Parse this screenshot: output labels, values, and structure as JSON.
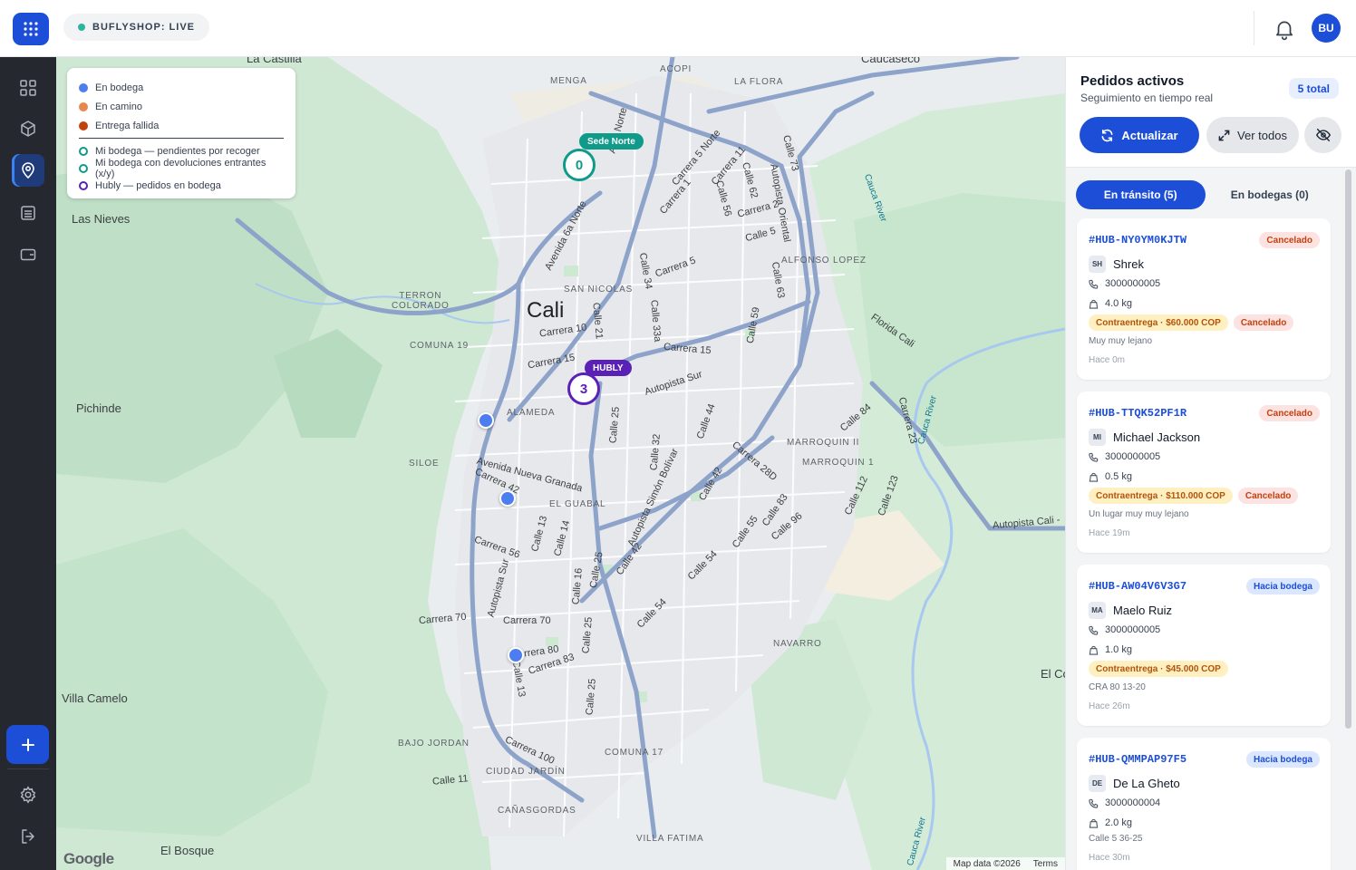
{
  "topbar": {
    "status_label": "BUFLYSHOP: LIVE",
    "avatar_initials": "BU",
    "colors": {
      "accent": "#1d4ed8",
      "status_dot": "#2bb5a0",
      "sidebar": "#25292f"
    }
  },
  "sidebar": {
    "items": [
      {
        "icon": "grid-icon",
        "active": false
      },
      {
        "icon": "package-icon",
        "active": false
      },
      {
        "icon": "map-pin-icon",
        "active": true
      },
      {
        "icon": "list-icon",
        "active": false
      },
      {
        "icon": "wallet-icon",
        "active": false
      }
    ],
    "bottom": [
      "plus-icon",
      "settings-icon",
      "logout-icon"
    ]
  },
  "map": {
    "legend": {
      "items": [
        {
          "label": "En bodega",
          "kind": "dot",
          "color": "#4d7ef0"
        },
        {
          "label": "En camino",
          "kind": "dot",
          "color": "#e8864d"
        },
        {
          "label": "Entrega fallida",
          "kind": "dot",
          "color": "#c2410c"
        },
        {
          "label": "Mi bodega — pendientes por recoger",
          "kind": "ring",
          "color": "#0f9a8a"
        },
        {
          "label": "Mi bodega con devoluciones entrantes (x/y)",
          "kind": "ring",
          "color": "#0f9a8a"
        },
        {
          "label": "Hubly — pedidos en bodega",
          "kind": "ring",
          "color": "#5b21b6"
        }
      ]
    },
    "clusters": {
      "sede_norte": {
        "tag": "Sede Norte",
        "count": "0",
        "color": "#0f9a8a"
      },
      "hubly": {
        "tag": "HUBLY",
        "count": "3",
        "color": "#5b21b6"
      }
    },
    "labels": {
      "la_castilla": "La Castilla",
      "cauca_seco": "Caucaseco",
      "acopi": "ACOPI",
      "menga": "MENGA",
      "la_flora": "LA FLORA",
      "las_nieves": "Las Nieves",
      "terron": "TERRON\nCOLORADO",
      "cali": "Cali",
      "san_nicolas": "SAN NICOLAS",
      "comuna19": "COMUNA 19",
      "pichinde": "Pichinde",
      "alameda": "ALAMEDA",
      "siloe": "SILOE",
      "el_guabal": "EL GUABAL",
      "alfonso_lopez": "ALFONSO LOPEZ",
      "marroquin2": "MARROQUIN II",
      "marroquin1": "MARROQUIN 1",
      "navarro": "NAVARRO",
      "villa_camelo": "Villa Camelo",
      "bajo_jordan": "BAJO JORDAN",
      "comuna17": "COMUNA 17",
      "ciudad_jardin": "CIUDAD JARDÍN",
      "canasgordas": "CAÑASGORDAS",
      "el_bosque": "El Bosque",
      "villa_fatima": "VILLA FATIMA",
      "el_co": "El Co",
      "av_6a": "Avenida 6a Norte",
      "av_4n": "Av 4 Norte",
      "carrera10": "Carrera 10",
      "carrera15a": "Carrera 15",
      "carrera15b": "Carrera 15",
      "carrera5": "Carrera 5",
      "carrera70": "Carrera 70",
      "carrera70b": "Carrera 70",
      "carrera80": "rrera 80",
      "carrera83": "Carrera 83",
      "autopista_sur": "Autopista Sur",
      "calle5": "Calle 5",
      "autopista_sur2": "Autopista Sur",
      "av_nueva_granada": "Avenida Nueva Granada",
      "carrera42": "Carrera 42",
      "carrera56": "Carrera 56",
      "calle25": "Calle 25",
      "calle44": "Calle 44",
      "calle100": "Carrera 100",
      "calle11": "Calle 11",
      "autopista_cali": "Autopista Cali -",
      "florida_cali": "Florida Cali",
      "cauca_river": "Cauca River",
      "cauca_river2": "Cauca River",
      "cauca_river3": "Cauca River",
      "calle73": "Calle 73",
      "calle62": "Calle 62",
      "calle56": "Calle 56",
      "calle34": "Calle 34",
      "calle33a": "Calle 33a",
      "calle21": "Calle 21",
      "calle59": "Calle 59",
      "calle63": "Calle 63",
      "calle84": "Calle 84",
      "calle112": "Calle 112",
      "calle123": "Calle 123",
      "calle13": "Calle 13",
      "calle14": "Calle 14",
      "calle16": "Calle 16",
      "carrera1": "Carrera 1",
      "carrera2": "Carrera 2",
      "carrera5n": "Carrera 5 Norte",
      "carrera11": "Carrera 11",
      "carrera23": "Carrera 23",
      "carrera28d": "Carrera 28D",
      "autopista_oriental": "Autopista Oriental",
      "autopista_simon": "Autopista Simón Bolívar",
      "calle42": "Calle 42",
      "calle54": "Calle 54",
      "calle32": "Calle 32",
      "calle55": "Calle 55",
      "calle83": "Calle 83",
      "calle96": "Calle 96",
      "calle13b": "Calle 13",
      "calle25b": "Calle 25",
      "calle25c": "Calle 25",
      "calle25d": "Calle 25",
      "calle42b": "Calle 42",
      "calle54b": "Calle 54"
    },
    "footer": {
      "data": "Map data ©2026",
      "terms": "Terms",
      "logo": "Google"
    }
  },
  "panel": {
    "title": "Pedidos activos",
    "subtitle": "Seguimiento en tiempo real",
    "count": "5 total",
    "refresh_label": "Actualizar",
    "view_all_label": "Ver todos",
    "tabs": [
      {
        "label": "En tránsito (5)",
        "active": true
      },
      {
        "label": "En bodegas (0)",
        "active": false
      }
    ],
    "orders": [
      {
        "id": "#HUB-NY0YM0KJTW",
        "status": "Cancelado",
        "status_kind": "red",
        "initials": "SH",
        "name": "Shrek",
        "phone": "3000000005",
        "weight": "4.0 kg",
        "cod": "Contraentrega · $60.000 COP",
        "extra_tag": "Cancelado",
        "address": "Muy muy lejano",
        "time": "Hace 0m"
      },
      {
        "id": "#HUB-TTQK52PF1R",
        "status": "Cancelado",
        "status_kind": "red",
        "initials": "MI",
        "name": "Michael Jackson",
        "phone": "3000000005",
        "weight": "0.5 kg",
        "cod": "Contraentrega · $110.000 COP",
        "extra_tag": "Cancelado",
        "address": "Un lugar muy muy lejano",
        "time": "Hace 19m"
      },
      {
        "id": "#HUB-AW04V6V3G7",
        "status": "Hacia bodega",
        "status_kind": "blue",
        "initials": "MA",
        "name": "Maelo Ruiz",
        "phone": "3000000005",
        "weight": "1.0 kg",
        "cod": "Contraentrega · $45.000 COP",
        "extra_tag": "",
        "address": "CRA 80 13-20",
        "time": "Hace 26m"
      },
      {
        "id": "#HUB-QMMPAP97F5",
        "status": "Hacia bodega",
        "status_kind": "blue",
        "initials": "DE",
        "name": "De La Gheto",
        "phone": "3000000004",
        "weight": "2.0 kg",
        "cod": "",
        "extra_tag": "",
        "address": "Calle 5 36-25",
        "time": "Hace 30m"
      }
    ]
  }
}
